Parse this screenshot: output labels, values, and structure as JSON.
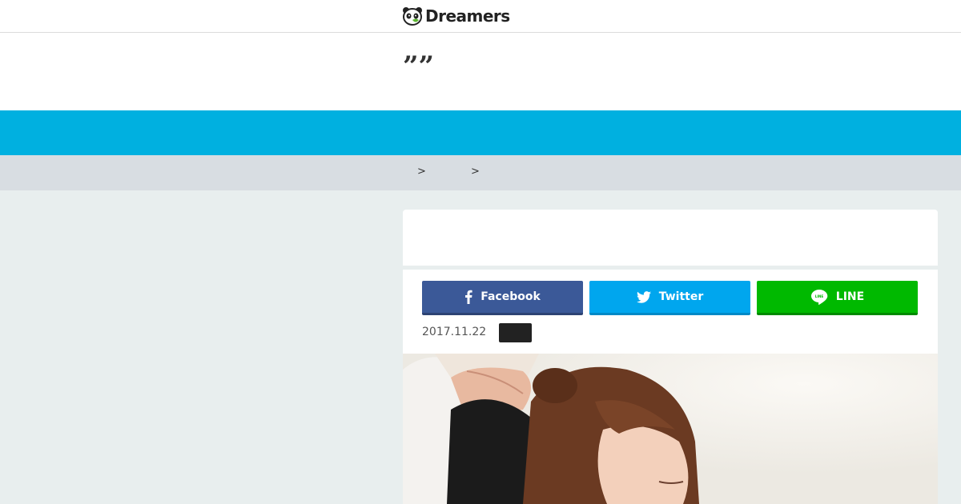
{
  "header": {
    "logo_text": "Dreamers",
    "logo_icon": "panda-icon"
  },
  "title_area": {
    "quote_marks": "””"
  },
  "breadcrumb": {
    "separators": [
      ">",
      ">"
    ]
  },
  "share": {
    "facebook_label": "Facebook",
    "twitter_label": "Twitter",
    "line_label": "LINE",
    "line_icon_text": "LINE",
    "colors": {
      "facebook": "#3b5998",
      "twitter": "#00a6ee",
      "line": "#00b900"
    }
  },
  "post": {
    "date": "2017.11.22"
  },
  "colors": {
    "accent": "#00b0e0",
    "breadcrumb_bg": "#d8dde2",
    "page_bg": "#e8eeee"
  }
}
